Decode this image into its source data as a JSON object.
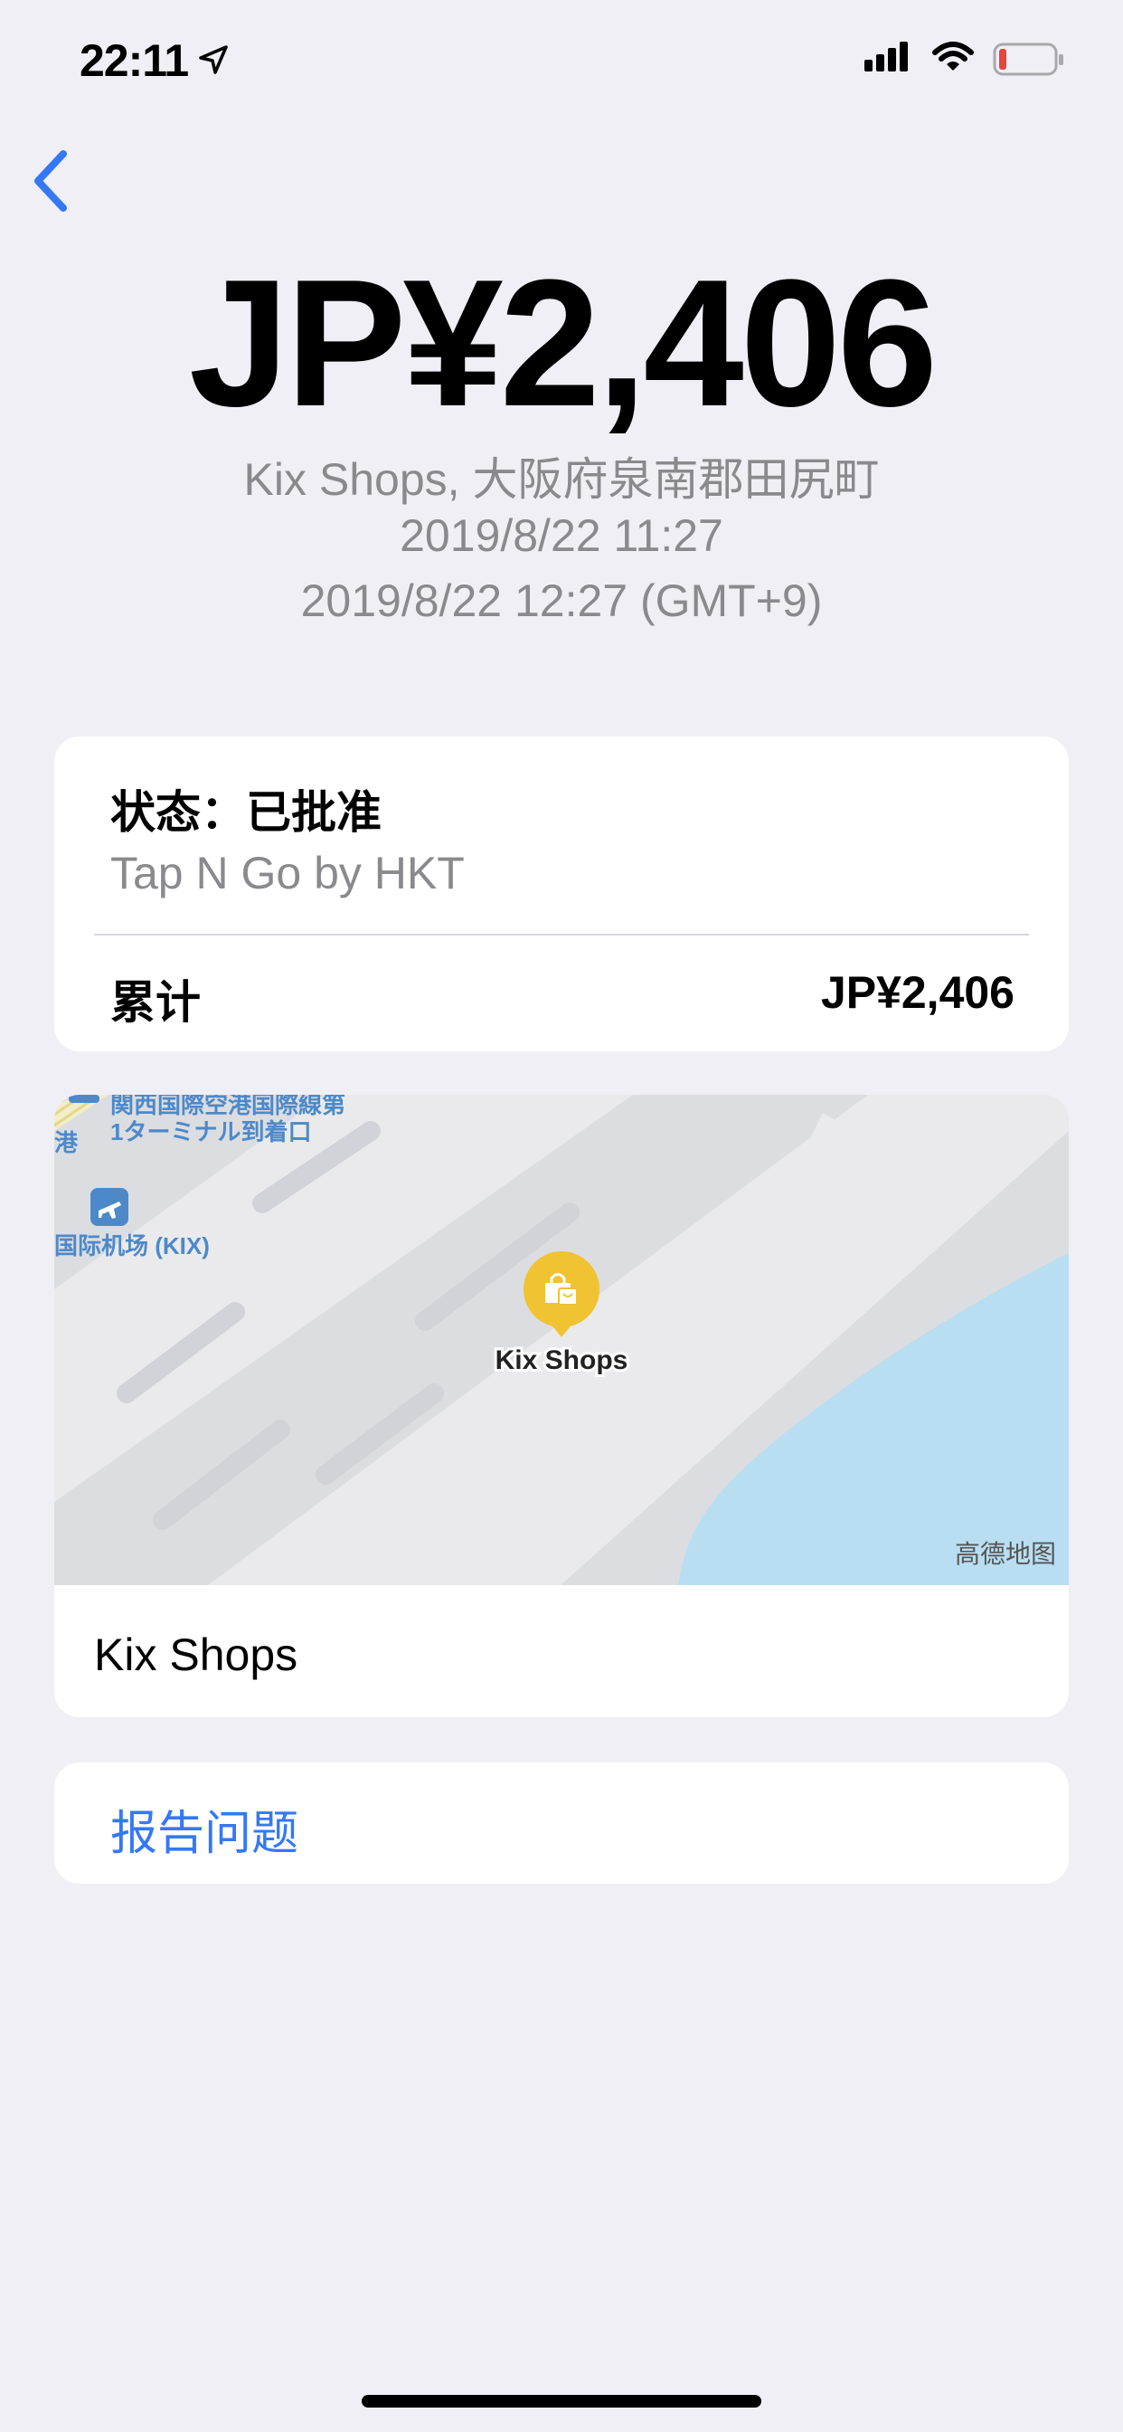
{
  "status_bar": {
    "time": "22:11"
  },
  "transaction": {
    "amount": "JP¥2,406",
    "merchant_location": "Kix Shops, 大阪府泉南郡田尻町",
    "datetime_local": "2019/8/22 11:27",
    "datetime_merchant": "2019/8/22 12:27 (GMT+9)"
  },
  "status_card": {
    "status": "状态：已批准",
    "issuer": "Tap N Go by HKT",
    "total_label": "累计",
    "total_value": "JP¥2,406"
  },
  "map": {
    "label_terminal_line1": "関西国際空港国際線第",
    "label_terminal_line2": "1ターミナル到着口",
    "label_port_fragment": "港",
    "label_airport": "国际机场 (KIX)",
    "pin_label": "Kix Shops",
    "attribution": "高德地图",
    "merchant_name": "Kix Shops",
    "colors": {
      "land": "#dcdde1",
      "road": "#eaeaec",
      "water": "#b9def2",
      "pin": "#f1c232",
      "label_blue": "#4d89c9"
    }
  },
  "report": {
    "label": "报告问题",
    "color": "#3478f6"
  }
}
